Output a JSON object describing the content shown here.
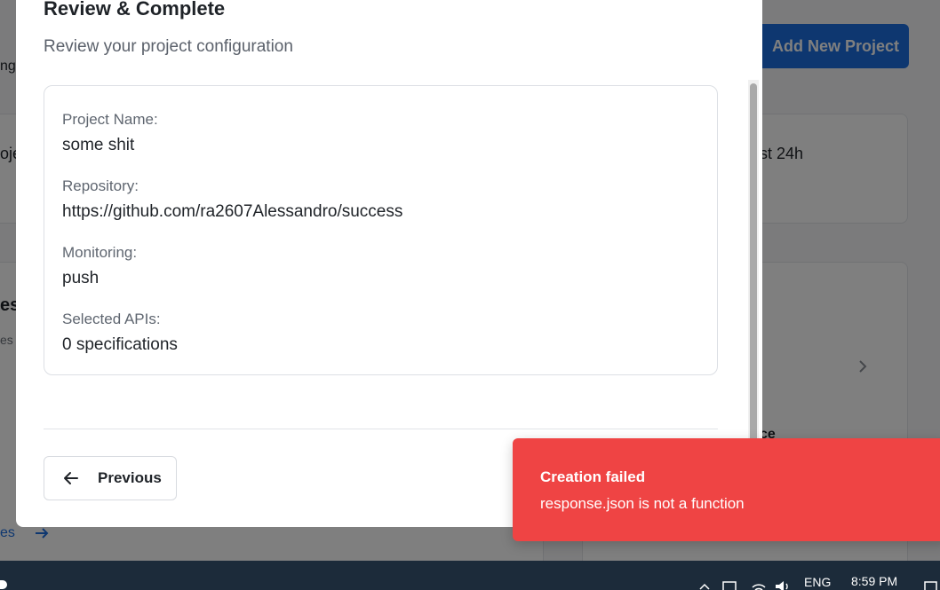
{
  "background": {
    "add_project_label": "Add New Project",
    "fragment_ng": "ng",
    "fragment_proje": "oje",
    "fragment_last24h": "st 24h",
    "fragment_es": "es",
    "fragment_es2": "es",
    "fragment_ce": "ce",
    "fragment_t": "t",
    "fragment_link": "es"
  },
  "modal": {
    "title": "Review & Complete",
    "subtitle": "Review your project configuration",
    "fields": [
      {
        "label": "Project Name:",
        "value": "some shit"
      },
      {
        "label": "Repository:",
        "value": "https://github.com/ra2607Alessandro/success"
      },
      {
        "label": "Monitoring:",
        "value": "push"
      },
      {
        "label": "Selected APIs:",
        "value": "0 specifications"
      }
    ],
    "previous_label": "Previous"
  },
  "toast": {
    "title": "Creation failed",
    "message": "response.json is not a function",
    "color": "#ef4444"
  },
  "taskbar": {
    "language": "ENG",
    "time": "8:59 PM"
  },
  "colors": {
    "primary": "#1d6fe0",
    "error": "#ef4444",
    "taskbar": "#1c2b3a"
  }
}
